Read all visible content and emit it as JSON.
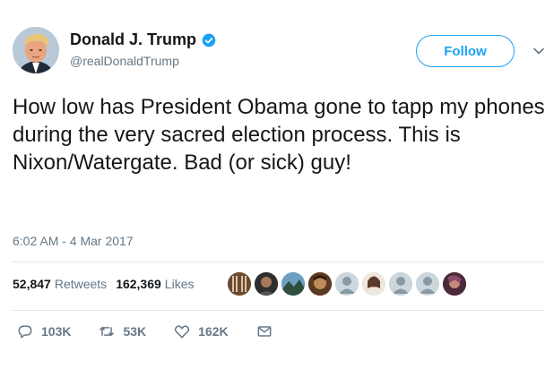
{
  "author": {
    "display_name": "Donald J. Trump",
    "handle": "@realDonaldTrump",
    "verified": true,
    "avatar_icon": "profile-photo"
  },
  "follow_label": "Follow",
  "tweet_text": "How low has President Obama gone to tapp my phones during the very sacred election process. This is Nixon/Watergate. Bad (or sick) guy!",
  "timestamp": "6:02 AM - 4 Mar 2017",
  "stats": {
    "retweets_count": "52,847",
    "retweets_label": "Retweets",
    "likes_count": "162,369",
    "likes_label": "Likes"
  },
  "actions": {
    "reply_count": "103K",
    "retweet_count": "53K",
    "like_count": "162K"
  },
  "colors": {
    "accent": "#1da1f2",
    "text": "#14171a",
    "muted": "#657786",
    "divider": "#e1e8ed"
  }
}
